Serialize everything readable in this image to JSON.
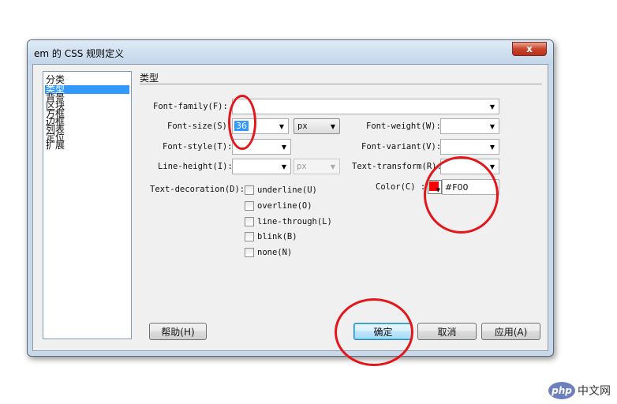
{
  "window": {
    "title": "em 的 CSS 规则定义",
    "close_glyph": "x"
  },
  "category": {
    "title": "分类",
    "items": [
      "类型",
      "背景",
      "区块",
      "方框",
      "边框",
      "列表",
      "定位",
      "扩展"
    ],
    "selected": "类型"
  },
  "group_title": "类型",
  "labels": {
    "font_family": "Font-family(F):",
    "font_size": "Font-size(S):",
    "font_style": "Font-style(T):",
    "line_height": "Line-height(I):",
    "text_decoration": "Text-decoration(D):",
    "font_weight": "Font-weight(W):",
    "font_variant": "Font-variant(V):",
    "text_transform": "Text-transform(R):",
    "color": "Color(C) :"
  },
  "values": {
    "font_family": "",
    "font_size": "36",
    "font_size_unit": "px",
    "font_style": "",
    "line_height": "",
    "line_height_unit": "px",
    "font_weight": "",
    "font_variant": "",
    "text_transform": "",
    "color": "#F00"
  },
  "decorations": [
    {
      "label": "underline(U)",
      "checked": false
    },
    {
      "label": "overline(O)",
      "checked": false
    },
    {
      "label": "line-through(L)",
      "checked": false
    },
    {
      "label": "blink(B)",
      "checked": false
    },
    {
      "label": "none(N)",
      "checked": false
    }
  ],
  "buttons": {
    "help": "帮助(H)",
    "ok": "确定",
    "cancel": "取消",
    "apply": "应用(A)"
  },
  "colors": {
    "swatch": "#ff0000",
    "annotation_ring": "#e3161b"
  },
  "watermark": {
    "logo": "php",
    "text": "中文网"
  }
}
